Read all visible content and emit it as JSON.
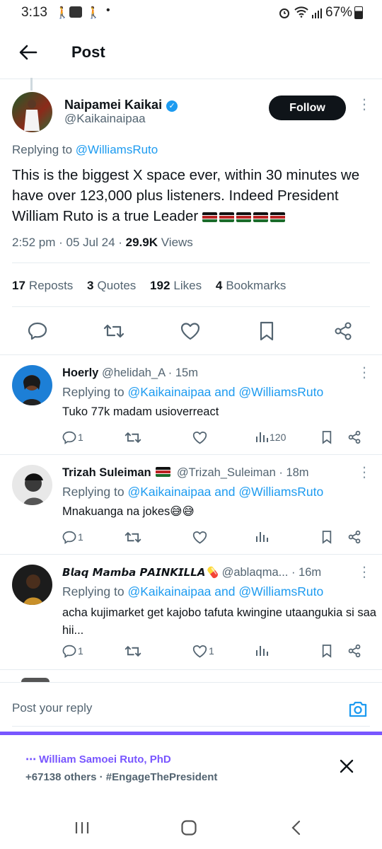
{
  "status_bar": {
    "time": "3:13",
    "battery": "67%"
  },
  "header": {
    "title": "Post"
  },
  "main_post": {
    "name": "Naipamei Kaikai",
    "handle": "@Kaikainaipaa",
    "follow_label": "Follow",
    "replying_prefix": "Replying to",
    "replying_to": "@WilliamsRuto",
    "text": "This is the biggest X space ever, within 30 minutes we have over 123,000 plus listeners. Indeed President William Ruto is a true Leader",
    "time": "2:52 pm · 05 Jul 24 ·",
    "views_count": "29.9K",
    "views_label": "Views",
    "reposts_count": "17",
    "reposts_label": "Reposts",
    "quotes_count": "3",
    "quotes_label": "Quotes",
    "likes_count": "192",
    "likes_label": "Likes",
    "bookmarks_count": "4",
    "bookmarks_label": "Bookmarks"
  },
  "replies": [
    {
      "name": "Hoerly",
      "handle": "@helidah_A",
      "time": "· 15m",
      "replying_prefix": "Replying to",
      "replying_to": "@Kaikainaipaa and @WilliamsRuto",
      "text": "Tuko 77k madam usioverreact",
      "reply_count": "1",
      "like_count": "",
      "views": "120"
    },
    {
      "name": "Trizah Suleiman",
      "handle": "@Trizah_Suleiman",
      "time": "· 18m",
      "replying_prefix": "Replying to",
      "replying_to": "@Kaikainaipaa and @WilliamsRuto",
      "text": "Mnakuanga na jokes😅😅",
      "reply_count": "1",
      "like_count": "",
      "views": ""
    },
    {
      "name": "𝘽𝙡𝙖𝙦 𝙈𝙖𝙢𝙗𝙖 𝙋𝘼𝙄𝙉𝙆𝙄𝙇𝙇𝘼💊",
      "handle": "@ablaqma...",
      "time": "· 16m",
      "replying_prefix": "Replying to",
      "replying_to": "@Kaikainaipaa and @WilliamsRuto",
      "text": "acha kujimarket get kajobo tafuta kwingine utaangukia si saa hii...",
      "reply_count": "1",
      "like_count": "1",
      "views": ""
    }
  ],
  "compose": {
    "placeholder": "Post your reply"
  },
  "space": {
    "host": "William Samoei Ruto, PhD",
    "subtitle": "+67138 others · #EngageThePresident"
  },
  "colors": {
    "accent": "#1d9bf0",
    "space": "#7856ff",
    "text": "#0f1419",
    "muted": "#536471"
  }
}
